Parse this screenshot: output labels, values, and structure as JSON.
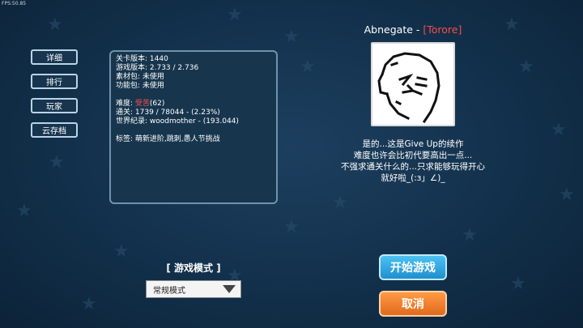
{
  "fps": "FPS:50.85",
  "side_buttons": [
    "详细",
    "排行",
    "玩家",
    "云存档"
  ],
  "info": {
    "level_version": "关卡版本: 1440",
    "game_version": "游戏版本: 2.733 / 2.736",
    "material_pack": "素材包: 未使用",
    "function_pack": "功能包: 未使用",
    "difficulty_prefix": "难度: ",
    "difficulty_name": "受苦",
    "difficulty_value": "(62)",
    "clears": "通关: 1739 / 78044 - (2.23%)",
    "world_record": "世界纪录: woodmother - (193.044)",
    "tags": "标签: 萌新进阶,跳刺,愚人节挑战"
  },
  "author": {
    "name": "Abnegate - ",
    "tag": "[Torore]",
    "accent": "#ff4848"
  },
  "description": [
    "是的...这是Give Up的续作",
    "难度也许会比初代要高出一点...",
    "不强求通关什么的...只求能够玩得开心",
    "就好啦_(:з」∠)_"
  ],
  "mode": {
    "label": "[ 游戏模式 ]",
    "selected": "常规模式"
  },
  "start_label": "开始游戏",
  "cancel_label": "取消"
}
